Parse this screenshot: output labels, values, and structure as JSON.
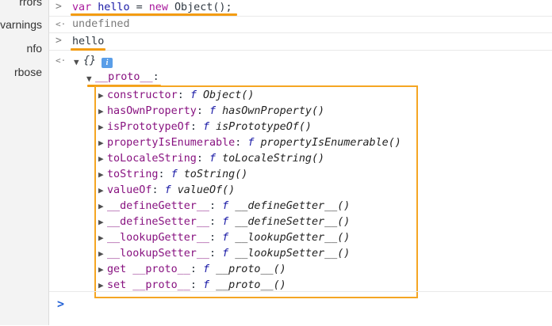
{
  "sidebar": {
    "items": [
      {
        "label": "rrors"
      },
      {
        "label": "varnings"
      },
      {
        "label": "nfo"
      },
      {
        "label": "rbose"
      }
    ]
  },
  "console": {
    "prompt_symbol": ">",
    "result_symbol": "<·",
    "entry1": {
      "kw_var": "var",
      "var_name": "hello",
      "op": " = ",
      "kw_new": "new",
      "rest": " Object();",
      "result": "undefined"
    },
    "entry2": {
      "input": "hello",
      "object_preview": "{}",
      "info_badge": "i",
      "proto_key": "__proto__",
      "proto_colon": ":"
    },
    "proto_members": [
      {
        "key": "constructor",
        "sig": "Object()"
      },
      {
        "key": "hasOwnProperty",
        "sig": "hasOwnProperty()"
      },
      {
        "key": "isPrototypeOf",
        "sig": "isPrototypeOf()"
      },
      {
        "key": "propertyIsEnumerable",
        "sig": "propertyIsEnumerable()"
      },
      {
        "key": "toLocaleString",
        "sig": "toLocaleString()"
      },
      {
        "key": "toString",
        "sig": "toString()"
      },
      {
        "key": "valueOf",
        "sig": "valueOf()"
      },
      {
        "key": "__defineGetter__",
        "sig": "__defineGetter__()"
      },
      {
        "key": "__defineSetter__",
        "sig": "__defineSetter__()"
      },
      {
        "key": "__lookupGetter__",
        "sig": "__lookupGetter__()"
      },
      {
        "key": "__lookupSetter__",
        "sig": "__lookupSetter__()"
      },
      {
        "key": "get __proto__",
        "sig": "__proto__()"
      },
      {
        "key": "set __proto__",
        "sig": "__proto__()"
      }
    ],
    "fn_marker": "f",
    "input_chevron": ">"
  },
  "colors": {
    "highlight": "#f5a623",
    "keyword": "#a8189c",
    "variable": "#1a1aa6",
    "property_key": "#881280",
    "info_badge": "#5a9ee8"
  }
}
